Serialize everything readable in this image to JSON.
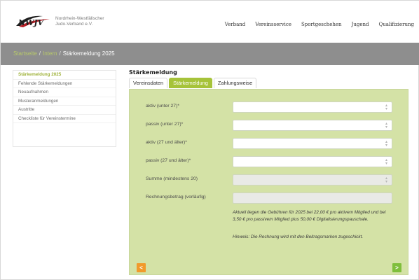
{
  "header": {
    "org_line1": "Nordrhein-Westfälischer",
    "org_line2": "Judo-Verband e.V.",
    "nav": [
      "Verband",
      "Vereinsservice",
      "Sportgeschehen",
      "Jugend",
      "Qualifizierung"
    ]
  },
  "breadcrumb": {
    "items": [
      "Startseite",
      "Intern",
      "Stärkemeldung 2025"
    ],
    "separator": "/"
  },
  "sidebar": {
    "items": [
      {
        "label": "Stärkemeldung 2025",
        "active": true
      },
      {
        "label": "Fehlende Stärkemeldungen",
        "active": false
      },
      {
        "label": "Neuaufnahmen",
        "active": false
      },
      {
        "label": "Musteranmeldungen",
        "active": false
      },
      {
        "label": "Austritte",
        "active": false
      },
      {
        "label": "Checkliste für Vereinstermine",
        "active": false
      }
    ]
  },
  "main": {
    "title": "Stärkemeldung",
    "tabs": [
      {
        "label": "Vereinsdaten",
        "active": false
      },
      {
        "label": "Stärkemeldung",
        "active": true
      },
      {
        "label": "Zahlungsweise",
        "active": false
      }
    ],
    "fields": [
      {
        "label": "aktiv (unter 27)*",
        "value": "",
        "disabled": false
      },
      {
        "label": "passiv (unter 27)*",
        "value": "",
        "disabled": false
      },
      {
        "label": "aktiv (27 und älter)*",
        "value": "",
        "disabled": false
      },
      {
        "label": "passiv (27 und älter)*",
        "value": "",
        "disabled": false
      },
      {
        "label": "Summe (mindestens 20)",
        "value": "",
        "disabled": true
      },
      {
        "label": "Rechnungsbetrag (vorläufig)",
        "value": "",
        "disabled": true
      }
    ],
    "note1": "Aktuell liegen die Gebühren für 2025 bei 22,00 € pro aktivem Mitglied und bei 3,50 € pro passivem Mitglied plus 50,00 € Digitalisierungspauschale.",
    "note2": "Hinweis: Die Rechnung wird mit den Beitragsmarken zugeschickt.",
    "prev_label": "<",
    "next_label": ">"
  },
  "colors": {
    "accent_green": "#a6c33a",
    "panel_green": "#d4e2a6",
    "prev_orange": "#f19a2b",
    "next_green": "#7fbf3c",
    "breadcrumb_bg": "#8e8e8e"
  }
}
